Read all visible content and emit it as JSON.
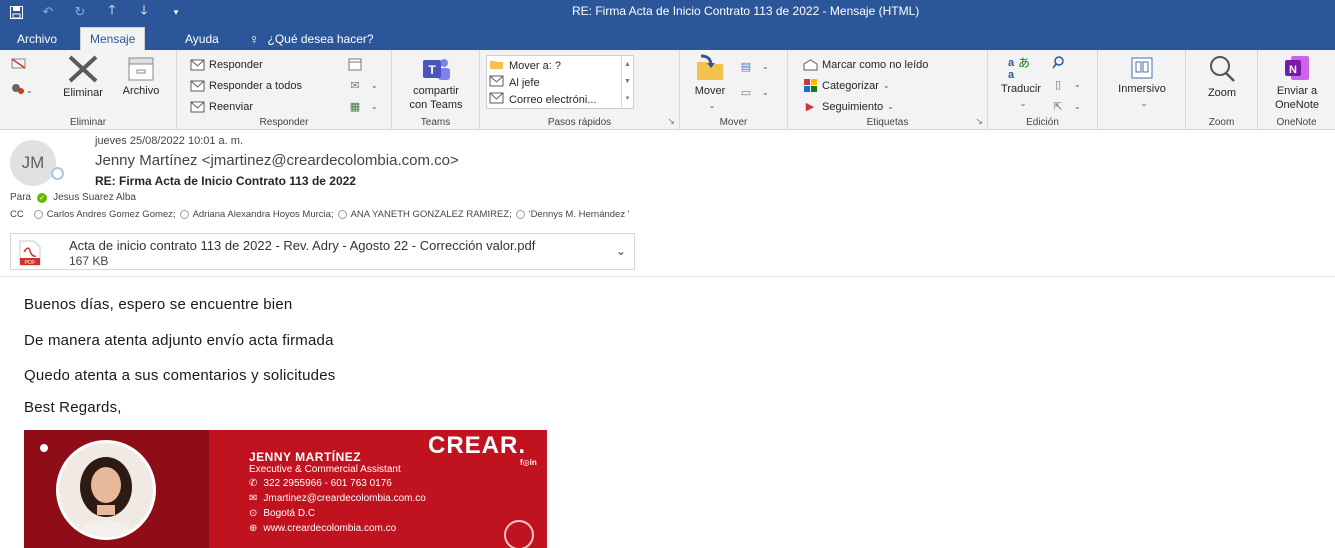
{
  "window": {
    "title": "RE: Firma Acta de Inicio Contrato 113 de 2022  -  Mensaje (HTML)"
  },
  "qat": {
    "icons": [
      "save-icon",
      "undo-icon",
      "redo-icon",
      "up-arrow-icon",
      "down-arrow-icon",
      "customize-icon"
    ]
  },
  "tabs": [
    {
      "label": "Archivo"
    },
    {
      "label": "Mensaje"
    },
    {
      "label": "Ayuda"
    },
    {
      "label": "¿Qué desea hacer?"
    }
  ],
  "ribbon": {
    "eliminar": {
      "group_label": "Eliminar",
      "delete_label": "Eliminar",
      "archive_label": "Archivo"
    },
    "responder": {
      "group_label": "Responder",
      "reply": "Responder",
      "reply_all": "Responder a todos",
      "forward": "Reenviar"
    },
    "teams": {
      "group_label": "Teams",
      "share_line1": "compartir",
      "share_line2": "con Teams"
    },
    "pasos": {
      "group_label": "Pasos rápidos",
      "items": [
        "Mover a: ?",
        "Al jefe",
        "Correo electróni..."
      ]
    },
    "mover": {
      "group_label": "Mover",
      "move_label": "Mover"
    },
    "etiquetas": {
      "group_label": "Etiquetas",
      "mark_unread": "Marcar como no leído",
      "categorize": "Categorizar",
      "followup": "Seguimiento"
    },
    "edicion": {
      "group_label": "Edición",
      "translate": "Traducir"
    },
    "inmersivo": {
      "label": "Inmersivo"
    },
    "zoom": {
      "group_label": "Zoom",
      "label": "Zoom"
    },
    "onenote": {
      "group_label": "OneNote",
      "line1": "Enviar a",
      "line2": "OneNote"
    }
  },
  "message": {
    "avatar_initials": "JM",
    "date": "jueves 25/08/2022 10:01 a. m.",
    "from": "Jenny Martínez <jmartinez@creardecolombia.com.co>",
    "subject": "RE: Firma Acta de Inicio Contrato 113 de 2022",
    "to_label": "Para",
    "to": "Jesus Suarez Alba",
    "cc_label": "CC",
    "cc": [
      "Carlos Andres Gomez Gomez;",
      "Adriana Alexandra Hoyos Murcia;",
      "ANA YANETH GONZALEZ RAMIREZ;",
      "'Dennys M. Hernández '"
    ]
  },
  "attachment": {
    "name": "Acta de inicio contrato  113 de 2022 - Rev. Adry - Agosto 22 - Corrección valor.pdf",
    "size": "167 KB",
    "icon_text": "PDF"
  },
  "body": {
    "lines": [
      "Buenos días, espero se encuentre bien",
      "De manera atenta adjunto envío acta firmada",
      "Quedo atenta a sus comentarios y solicitudes",
      "Best Regards,"
    ]
  },
  "signature": {
    "name": "JENNY MARTÍNEZ",
    "role": "Executive & Commercial Assistant",
    "phone": "322 2955966 - 601 763 0176",
    "email": "Jmartinez@creardecolombia.com.co",
    "city": "Bogotá D.C",
    "web": "www.creardecolombia.com.co",
    "logo": "CREAR.",
    "social": "f◎in"
  },
  "colors": {
    "accent": "#2b579a",
    "ribbon_bg": "#f3f3f3",
    "signature_red": "#c1121f",
    "presence_green": "#6bb700"
  }
}
